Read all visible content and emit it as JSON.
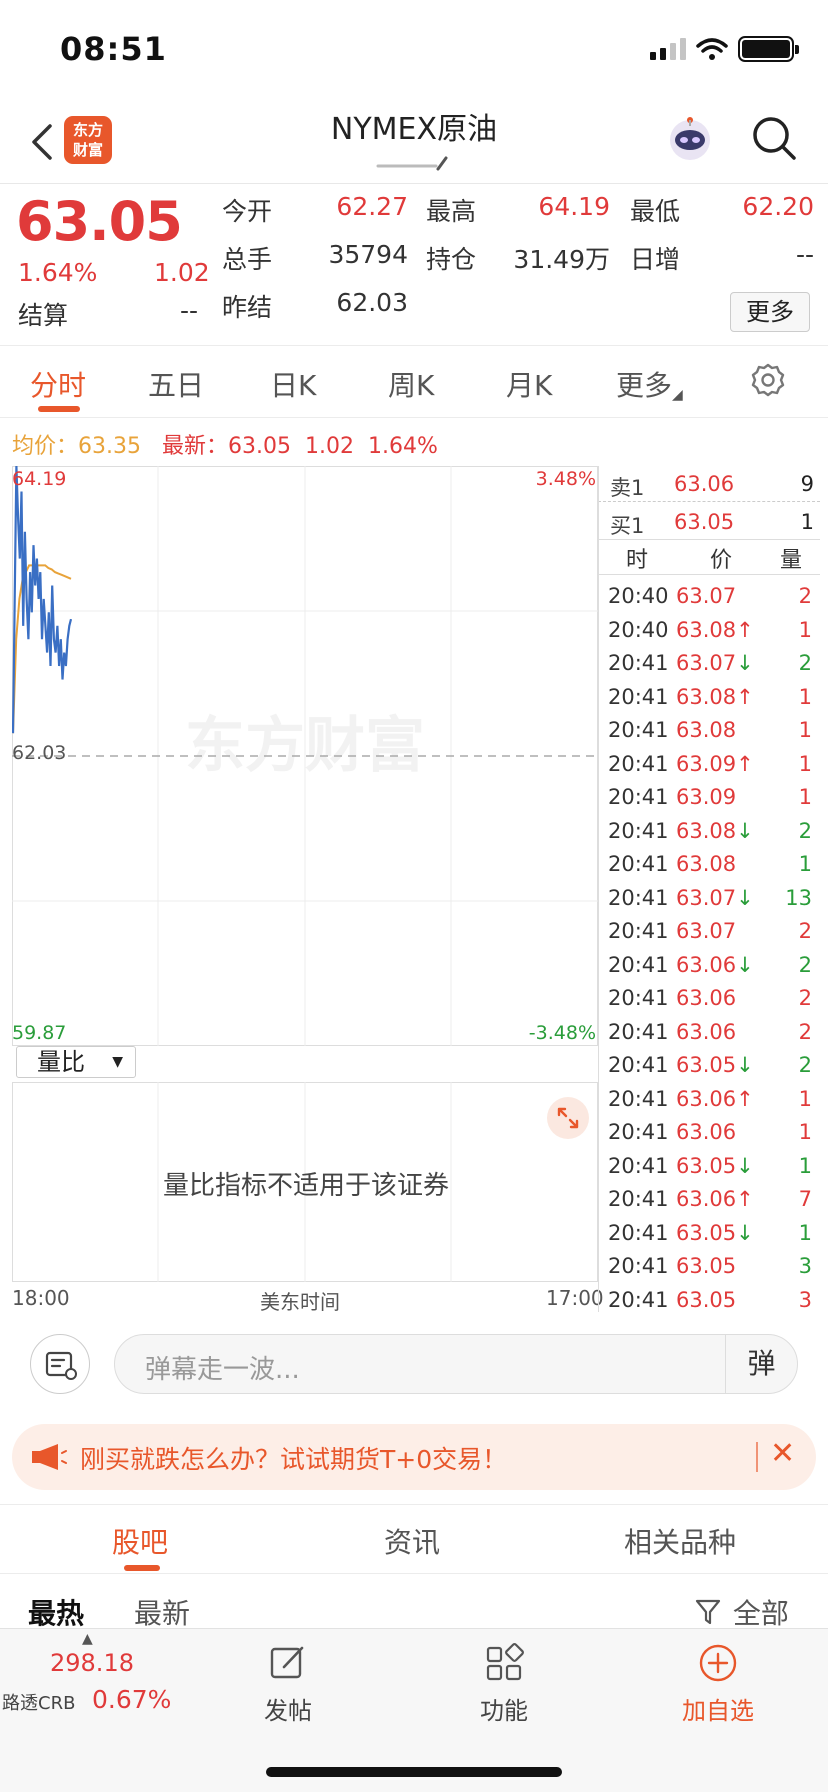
{
  "status_bar": {
    "time": "08:51"
  },
  "nav": {
    "logo_line1": "东方",
    "logo_line2": "财富",
    "title": "NYMEX原油"
  },
  "quote": {
    "price": "63.05",
    "change_pct": "1.64%",
    "change": "1.02",
    "settle_label": "结算",
    "settle_value": "--",
    "open_label": "今开",
    "open_value": "62.27",
    "high_label": "最高",
    "high_value": "64.19",
    "low_label": "最低",
    "low_value": "62.20",
    "volume_label": "总手",
    "volume_value": "35794",
    "oi_label": "持仓",
    "oi_value": "31.49万",
    "daily_inc_label": "日增",
    "daily_inc_value": "--",
    "prev_settle_label": "昨结",
    "prev_settle_value": "62.03",
    "more_label": "更多"
  },
  "tabs": [
    "分时",
    "五日",
    "日K",
    "周K",
    "月K",
    "更多"
  ],
  "avg_line": {
    "avg_label": "均价：",
    "avg_value": "63.35",
    "latest_label": "最新：",
    "latest_value": "63.05",
    "latest_change": "1.02",
    "latest_pct": "1.64%"
  },
  "chart_labels": {
    "top_price": "64.19",
    "top_pct": "3.48%",
    "mid_price": "62.03",
    "bottom_price": "59.87",
    "bottom_pct": "-3.48%",
    "watermark": "东方财富"
  },
  "chart_data": {
    "type": "line",
    "ylim": [
      59.87,
      64.19
    ],
    "reference": 62.03,
    "series": [
      {
        "values": [
          62.2,
          63.2,
          64.19,
          63.8,
          63.5,
          64.0,
          63.0,
          63.7,
          63.2,
          62.9,
          63.4,
          63.1,
          63.6,
          63.3,
          63.5,
          63.2,
          63.4,
          62.9,
          63.2,
          63.0,
          62.8,
          63.1,
          62.7,
          63.3,
          62.9,
          62.8,
          63.0,
          62.7,
          62.9,
          62.6,
          62.8,
          62.7,
          62.9,
          63.0,
          63.05
        ]
      },
      {
        "values": [
          62.2,
          62.9,
          63.2,
          63.35,
          63.4,
          63.45,
          63.45,
          63.45,
          63.45,
          63.45,
          63.45,
          63.43,
          63.42,
          63.4,
          63.39,
          63.38,
          63.37,
          63.36,
          63.35
        ]
      }
    ]
  },
  "indicator": {
    "select_label": "量比",
    "message": "量比指标不适用于该证券"
  },
  "time_axis": {
    "start": "18:00",
    "middle": "美东时间",
    "end": "17:00"
  },
  "order_book": [
    {
      "label": "卖1",
      "price": "63.06",
      "vol": "9"
    },
    {
      "label": "买1",
      "price": "63.05",
      "vol": "1"
    }
  ],
  "trades_header": {
    "time": "时",
    "price": "价",
    "vol": "量"
  },
  "trades": [
    {
      "time": "20:40",
      "price": "63.07",
      "dir": "",
      "vol": "2",
      "vc": "red"
    },
    {
      "time": "20:40",
      "price": "63.08",
      "dir": "↑",
      "vol": "1",
      "vc": "red"
    },
    {
      "time": "20:41",
      "price": "63.07",
      "dir": "↓",
      "vol": "2",
      "vc": "green"
    },
    {
      "time": "20:41",
      "price": "63.08",
      "dir": "↑",
      "vol": "1",
      "vc": "red"
    },
    {
      "time": "20:41",
      "price": "63.08",
      "dir": "",
      "vol": "1",
      "vc": "red"
    },
    {
      "time": "20:41",
      "price": "63.09",
      "dir": "↑",
      "vol": "1",
      "vc": "red"
    },
    {
      "time": "20:41",
      "price": "63.09",
      "dir": "",
      "vol": "1",
      "vc": "red"
    },
    {
      "time": "20:41",
      "price": "63.08",
      "dir": "↓",
      "vol": "2",
      "vc": "green"
    },
    {
      "time": "20:41",
      "price": "63.08",
      "dir": "",
      "vol": "1",
      "vc": "green"
    },
    {
      "time": "20:41",
      "price": "63.07",
      "dir": "↓",
      "vol": "13",
      "vc": "green"
    },
    {
      "time": "20:41",
      "price": "63.07",
      "dir": "",
      "vol": "2",
      "vc": "red"
    },
    {
      "time": "20:41",
      "price": "63.06",
      "dir": "↓",
      "vol": "2",
      "vc": "green"
    },
    {
      "time": "20:41",
      "price": "63.06",
      "dir": "",
      "vol": "2",
      "vc": "red"
    },
    {
      "time": "20:41",
      "price": "63.06",
      "dir": "",
      "vol": "2",
      "vc": "red"
    },
    {
      "time": "20:41",
      "price": "63.05",
      "dir": "↓",
      "vol": "2",
      "vc": "green"
    },
    {
      "time": "20:41",
      "price": "63.06",
      "dir": "↑",
      "vol": "1",
      "vc": "red"
    },
    {
      "time": "20:41",
      "price": "63.06",
      "dir": "",
      "vol": "1",
      "vc": "red"
    },
    {
      "time": "20:41",
      "price": "63.05",
      "dir": "↓",
      "vol": "1",
      "vc": "green"
    },
    {
      "time": "20:41",
      "price": "63.06",
      "dir": "↑",
      "vol": "7",
      "vc": "red"
    },
    {
      "time": "20:41",
      "price": "63.05",
      "dir": "↓",
      "vol": "1",
      "vc": "green"
    },
    {
      "time": "20:41",
      "price": "63.05",
      "dir": "",
      "vol": "3",
      "vc": "green"
    },
    {
      "time": "20:41",
      "price": "63.05",
      "dir": "",
      "vol": "3",
      "vc": "red"
    }
  ],
  "danmu": {
    "placeholder": "弹幕走一波...",
    "button": "弹"
  },
  "promo": {
    "text": "刚买就跌怎么办？试试期货T+0交易！"
  },
  "bottom_tabs": [
    "股吧",
    "资讯",
    "相关品种"
  ],
  "sub_tabs": {
    "hot": "最热",
    "latest": "最新",
    "filter": "全部"
  },
  "toolbar": {
    "crb_value": "298.18",
    "crb_name": "路透CRB",
    "crb_pct": "0.67%",
    "post": "发帖",
    "functions": "功能",
    "add_watch": "加自选"
  },
  "colors": {
    "up": "#e03a3a",
    "down": "#2a9d3a",
    "accent": "#e8572b",
    "price_line": "#3a6fc4",
    "avg_line": "#e8a33a"
  }
}
